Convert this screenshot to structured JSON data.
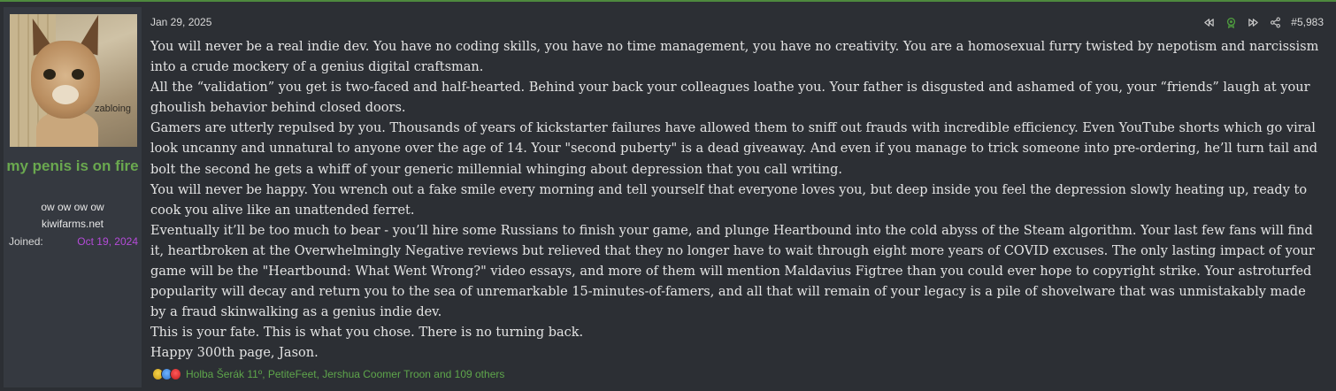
{
  "user": {
    "avatar_caption": "zabloing",
    "username": "my penis is on fire",
    "title_line1": "ow ow ow ow",
    "title_line2": "kiwifarms.net",
    "joined_label": "Joined:",
    "joined_value": "Oct 19, 2024"
  },
  "post": {
    "date": "Jan 29, 2025",
    "number": "#5,983",
    "paragraphs": [
      "You will never be a real indie dev. You have no coding skills, you have no time management, you have no creativity. You are a homosexual furry twisted by nepotism and narcissism into a crude mockery of a genius digital craftsman.",
      "All the “validation” you get is two-faced and half-hearted. Behind your back your colleagues loathe you. Your father is disgusted and ashamed of you, your “friends” laugh at your ghoulish behavior behind closed doors.",
      "Gamers are utterly repulsed by you. Thousands of years of kickstarter failures have allowed them to sniff out frauds with incredible efficiency. Even YouTube shorts which go viral look uncanny and unnatural to anyone over the age of 14. Your \"second puberty\" is a dead giveaway. And even if you manage to trick someone into pre-ordering, he’ll turn tail and bolt the second he gets a whiff of your generic millennial whinging about depression that you call writing.",
      "You will never be happy. You wrench out a fake smile every morning and tell yourself that everyone loves you, but deep inside you feel the depression slowly heating up, ready to cook you alive like an unattended ferret.",
      "Eventually it’ll be too much to bear - you’ll hire some Russians to finish your game, and plunge Heartbound into the cold abyss of the Steam algorithm. Your last few fans will find it, heartbroken at the Overwhelmingly Negative reviews but relieved that they no longer have to wait through eight more years of COVID excuses. The only lasting impact of your game will be the \"Heartbound: What Went Wrong?\" video essays, and more of them will mention Maldavius Figtree than you could ever hope to copyright strike. Your astroturfed popularity will decay and return you to the sea of unremarkable 15-minutes-of-famers, and all that will remain of your legacy is a pile of shovelware that was unmistakably made by a fraud skinwalking as a genius indie dev.",
      "This is your fate. This is what you chose. There is no turning back.",
      "Happy 300th page, Jason."
    ],
    "reactions_text": "Holba Šerák 11º, PetiteFeet, Jershua Coomer Troon and 109 others"
  },
  "icons": [
    "rewind-icon",
    "meme-icon",
    "forward-icon",
    "share-icon"
  ],
  "colors": {
    "accent_green": "#6aa84f",
    "joined_purple": "#b44bd8",
    "reactions_green": "#5ea54b",
    "top_border": "#4e8a3e"
  }
}
